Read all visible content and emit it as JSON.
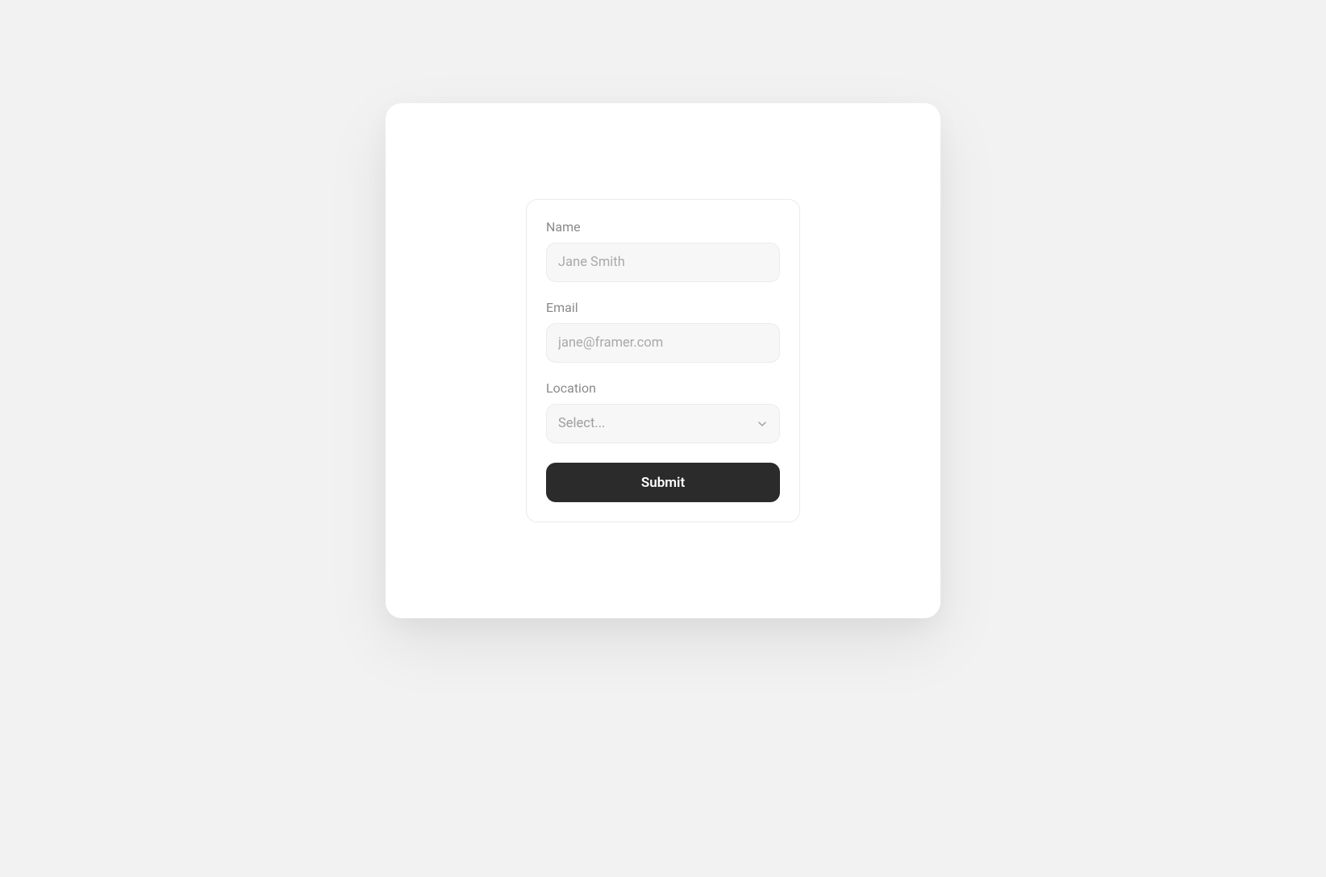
{
  "form": {
    "fields": {
      "name": {
        "label": "Name",
        "placeholder": "Jane Smith",
        "value": ""
      },
      "email": {
        "label": "Email",
        "placeholder": "jane@framer.com",
        "value": ""
      },
      "location": {
        "label": "Location",
        "placeholder": "Select...",
        "value": ""
      }
    },
    "submit_label": "Submit"
  }
}
